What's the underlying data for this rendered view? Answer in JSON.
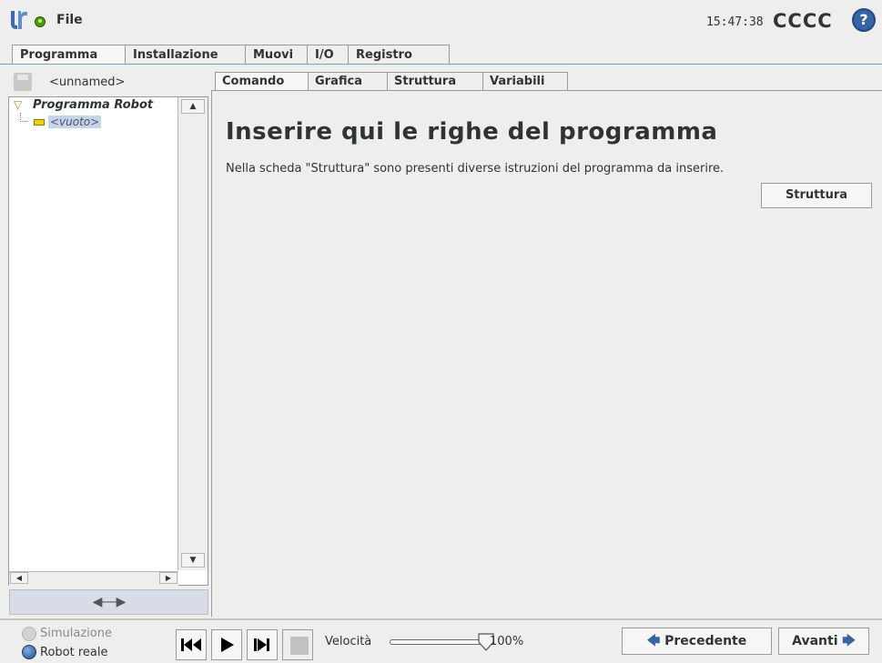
{
  "header": {
    "file_menu": "File",
    "clock": "15:47:38",
    "robot_name": "CCCC",
    "help_label": "?"
  },
  "main_tabs": [
    {
      "label": "Programma",
      "active": true
    },
    {
      "label": "Installazione",
      "active": false
    },
    {
      "label": "Muovi",
      "active": false
    },
    {
      "label": "I/O",
      "active": false
    },
    {
      "label": "Registro",
      "active": false
    }
  ],
  "left_panel": {
    "program_name": "<unnamed>",
    "tree": {
      "root_label": "Programma Robot",
      "child_label": "<vuoto>"
    },
    "scroll_up": "▲",
    "scroll_down": "▼",
    "scroll_left": "◀",
    "scroll_right": "▶",
    "resize_handle": "◀----▶"
  },
  "sub_tabs": [
    {
      "label": "Comando",
      "active": true
    },
    {
      "label": "Grafica",
      "active": false
    },
    {
      "label": "Struttura",
      "active": false
    },
    {
      "label": "Variabili",
      "active": false
    }
  ],
  "content": {
    "title": "Inserire qui le righe del programma",
    "description": "Nella scheda \"Struttura\" sono presenti diverse istruzioni del programma da inserire.",
    "struttura_button": "Struttura"
  },
  "bottom_bar": {
    "simulation_label": "Simulazione",
    "real_robot_label": "Robot reale",
    "speed_label": "Velocità",
    "speed_value": "100%",
    "speed_fraction": 1.0,
    "prev_button": "Precedente",
    "next_button": "Avanti",
    "prev_arrow": "🡄",
    "next_arrow": "🡆"
  },
  "colors": {
    "accent": "#3465a4",
    "status_ok": "#4e9a06",
    "tree_selection": "#c4d3ee"
  },
  "icons": {
    "logo": "ur-logo-icon",
    "status": "status-dot-icon",
    "help": "help-icon",
    "save": "save-icon"
  }
}
